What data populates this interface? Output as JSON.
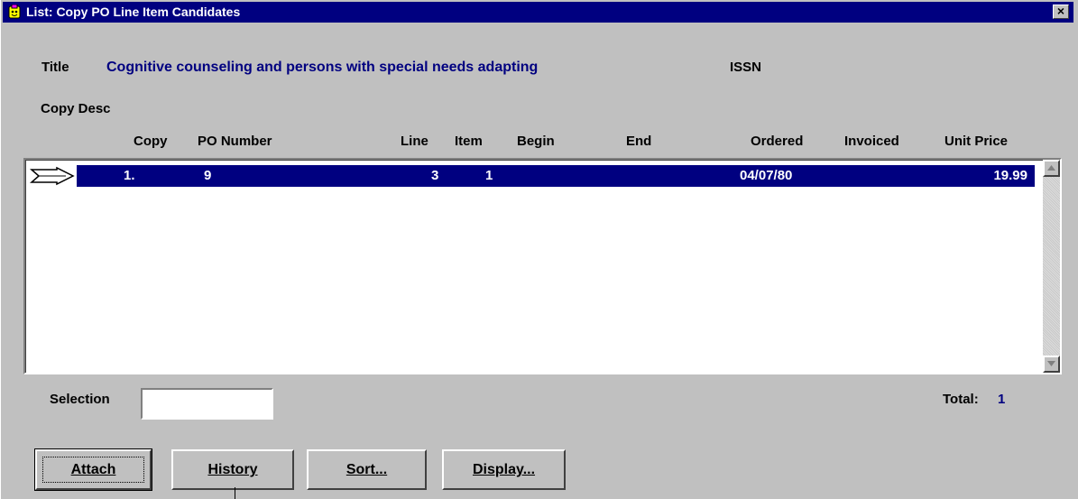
{
  "window": {
    "title": "List: Copy  PO Line Item Candidates",
    "close_glyph": "×"
  },
  "header": {
    "title_label": "Title",
    "title_value": "Cognitive counseling and persons with special needs adapting",
    "issn_label": "ISSN",
    "copy_desc_label": "Copy Desc"
  },
  "columns": {
    "copy": "Copy",
    "po_number": "PO Number",
    "line": "Line",
    "item": "Item",
    "begin": "Begin",
    "end": "End",
    "ordered": "Ordered",
    "invoiced": "Invoiced",
    "unit_price": "Unit Price"
  },
  "rows": [
    {
      "copy": "1.",
      "po_number": "9",
      "line": "3",
      "item": "1",
      "begin": "",
      "end": "",
      "ordered": "04/07/80",
      "invoiced": "",
      "unit_price": "19.99",
      "selected": true
    }
  ],
  "footer": {
    "selection_label": "Selection",
    "selection_value": "",
    "total_label": "Total:",
    "total_value": "1"
  },
  "buttons": {
    "attach": "Attach",
    "history": "History",
    "sort": "Sort...",
    "display": "Display..."
  },
  "icons": {
    "app": "app-icon",
    "pointer": "row-pointer-arrow-icon",
    "scroll_up": "scroll-up-arrow-icon",
    "scroll_down": "scroll-down-arrow-icon"
  },
  "colors": {
    "titlebar": "#000080",
    "selection": "#000080",
    "face": "#c0c0c0",
    "value_text": "#000080"
  }
}
